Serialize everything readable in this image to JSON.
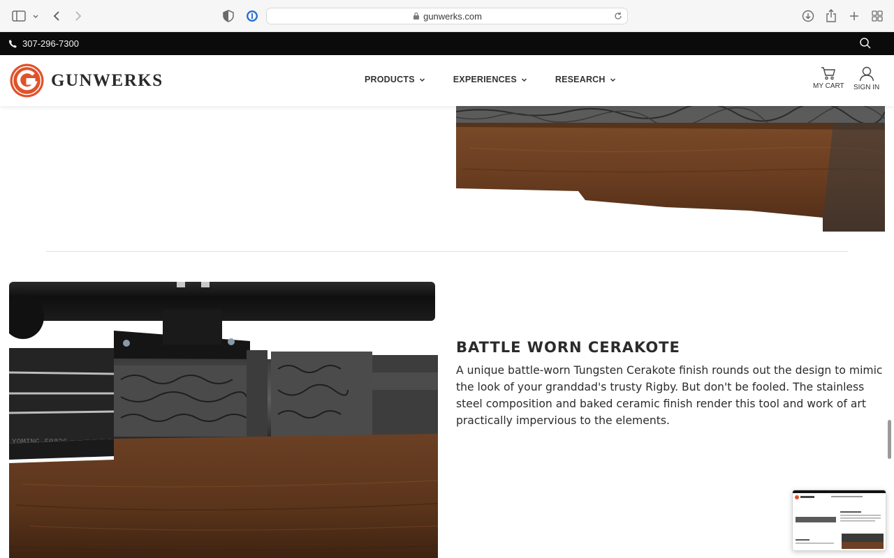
{
  "browser": {
    "url": "gunwerks.com",
    "icons": [
      "sidebar-icon",
      "chevron-down-icon",
      "back-icon",
      "forward-icon",
      "shield-icon",
      "password-icon",
      "lock-icon",
      "reload-icon",
      "download-icon",
      "share-icon",
      "new-tab-icon",
      "tab-overview-icon"
    ]
  },
  "utility_bar": {
    "phone": "307-296-7300",
    "icons": [
      "phone-icon",
      "search-icon"
    ]
  },
  "header": {
    "logo_text": "Gunwerks",
    "nav": [
      {
        "label": "PRODUCTS"
      },
      {
        "label": "EXPERIENCES"
      },
      {
        "label": "RESEARCH"
      }
    ],
    "cart_label": "MY CART",
    "signin_label": "SIGN IN"
  },
  "feature": {
    "title": "BATTLE WORN CERAKOTE",
    "text": "A unique battle-worn Tungsten Cerakote finish rounds out the design to mimic the look of your granddad's trusty Rigby. But don't be fooled. The stainless steel composition and baked ceramic finish render this tool and work of art practically impervious to the elements."
  },
  "colors": {
    "utility_bar": "#0b0b0b",
    "brand_orange": "#e0522a",
    "stock_wood": "#6b3f22",
    "steel": "#4a4a4a"
  }
}
